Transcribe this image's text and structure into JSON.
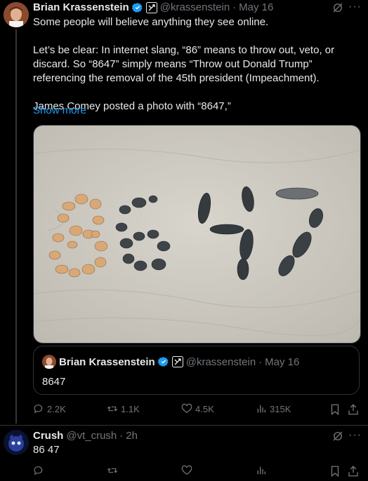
{
  "main_post": {
    "author_name": "Brian Krassenstein",
    "handle": "@krassenstein",
    "separator": "·",
    "date": "May 16",
    "text": "Some people will believe anything they see online.\n\nLet’s be clear: In internet slang, “86” means to throw out, veto, or discard. So “8647” simply means “Throw out Donald Trump” referencing the removal of the 45th president (Impeachment).\n\nJames Comey posted a photo with “8647,”",
    "show_more": "Show more",
    "quote": {
      "author_name": "Brian Krassenstein",
      "handle": "@krassenstein",
      "separator": "·",
      "date": "May 16",
      "text": "8647"
    },
    "stats": {
      "replies": "2.2K",
      "reposts": "1.1K",
      "likes": "4.5K",
      "views": "315K"
    }
  },
  "reply_post": {
    "author_name": "Crush",
    "handle": "@vt_crush",
    "separator": "·",
    "time": "2h",
    "text": "86 47"
  },
  "colors": {
    "background": "#000000",
    "text": "#e7e9ea",
    "muted": "#71767b",
    "link": "#1d9bf0",
    "border": "#2f3336"
  }
}
